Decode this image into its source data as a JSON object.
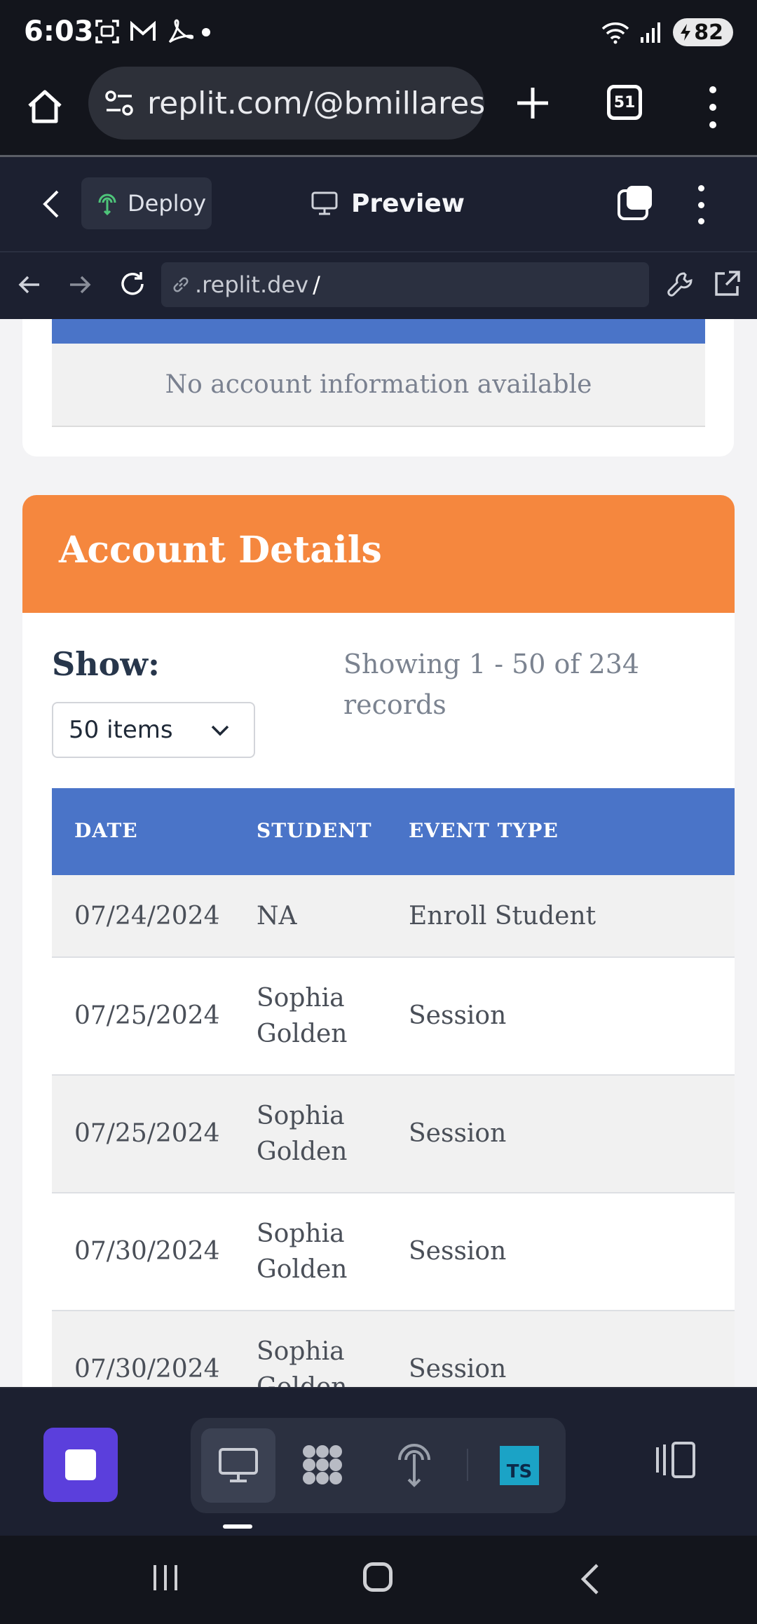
{
  "status_bar": {
    "time": "6:03",
    "battery": "82",
    "icons": [
      "screenshot-icon",
      "gmail-icon",
      "acrobat-icon",
      "wifi-icon",
      "signal-icon",
      "battery-charging-icon"
    ]
  },
  "browser": {
    "url": "replit.com/@bmillares/",
    "tab_count": "51"
  },
  "replit_toolbar": {
    "deploy_label": "Deploy",
    "preview_label": "Preview"
  },
  "webview": {
    "url_prefix": ".replit.dev",
    "url_suffix": "/"
  },
  "previous_section": {
    "empty_message": "No account information available"
  },
  "account_details": {
    "title": "Account Details",
    "show_label": "Show:",
    "items_select_value": "50 items",
    "records_info": "Showing 1 - 50 of 234 records",
    "columns": [
      "DATE",
      "STUDENT",
      "EVENT TYPE"
    ],
    "rows": [
      {
        "date": "07/24/2024",
        "student": "NA",
        "event": "Enroll Student"
      },
      {
        "date": "07/25/2024",
        "student": "Sophia Golden",
        "event": "Session"
      },
      {
        "date": "07/25/2024",
        "student": "Sophia Golden",
        "event": "Session"
      },
      {
        "date": "07/30/2024",
        "student": "Sophia Golden",
        "event": "Session"
      },
      {
        "date": "07/30/2024",
        "student": "Sophia Golden",
        "event": "Session"
      }
    ]
  },
  "dock": {
    "ts_label": "TS"
  },
  "colors": {
    "table_header": "#4a74c8",
    "details_header": "#f5873e",
    "stop_button": "#5b3fdc"
  }
}
